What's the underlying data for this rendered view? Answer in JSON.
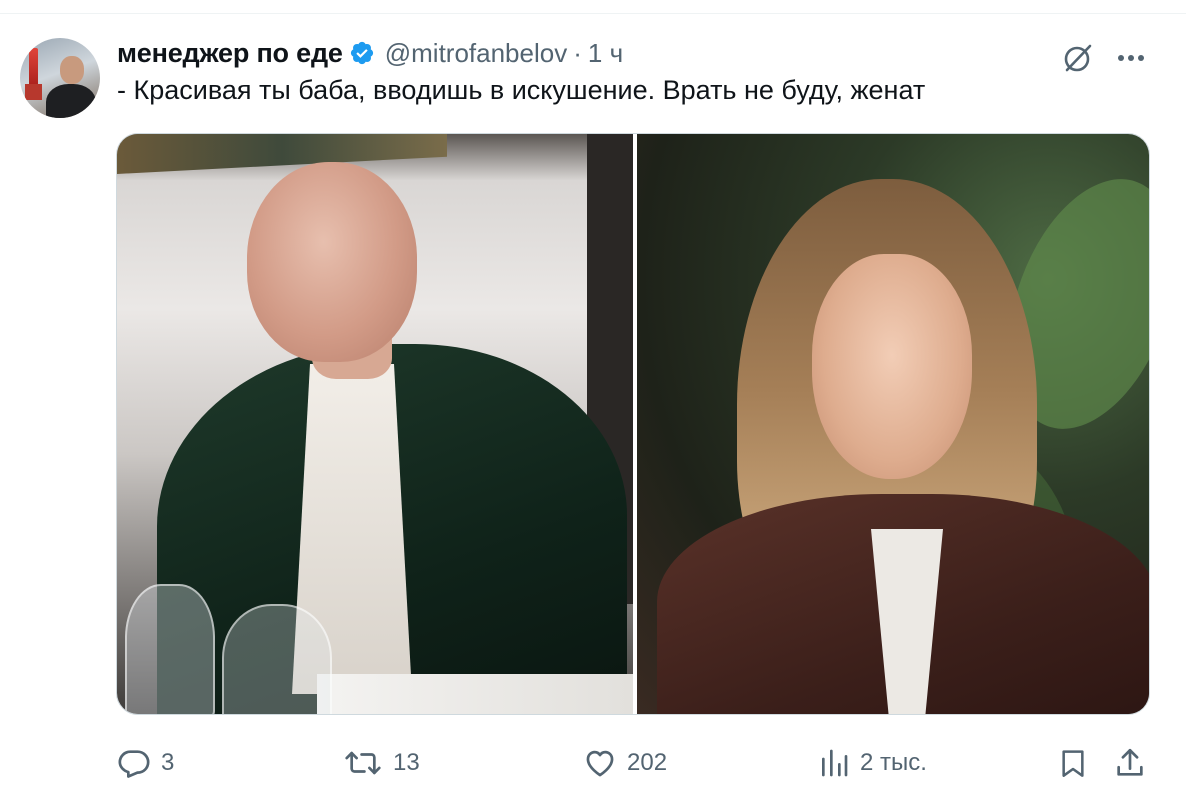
{
  "author": {
    "display_name": "менеджер по еде",
    "handle": "@mitrofanbelov",
    "separator": "·",
    "time": "1 ч",
    "verified": true
  },
  "tweet": {
    "text": "- Красивая ты баба, вводишь в искушение. Врать не буду, женат"
  },
  "actions": {
    "replies": "3",
    "retweets": "13",
    "likes": "202",
    "views": "2 тыс."
  },
  "icons": {
    "verified": "verified-badge-icon",
    "grok": "grok-icon",
    "more": "more-horizontal-icon",
    "reply": "reply-icon",
    "retweet": "retweet-icon",
    "like": "heart-icon",
    "views": "views-chart-icon",
    "bookmark": "bookmark-icon",
    "share": "share-icon"
  },
  "colors": {
    "accent": "#1d9bf0",
    "text_primary": "#0f1419",
    "text_secondary": "#536471",
    "border": "#cfd9de"
  }
}
